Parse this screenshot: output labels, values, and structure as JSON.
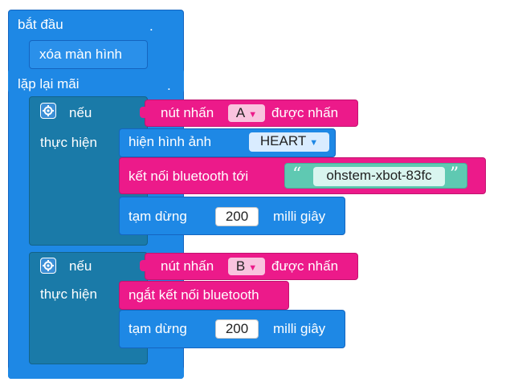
{
  "start_block": {
    "label": "bắt đầu",
    "dot": "."
  },
  "clear_block": {
    "label": "xóa màn hình"
  },
  "forever_block": {
    "label": "lặp lại mãi",
    "dot": "."
  },
  "if_blocks": [
    {
      "if_label": "nếu",
      "do_label": "thực hiện",
      "condition": {
        "prefix": "nút nhấn",
        "button": "A",
        "suffix": "được nhấn"
      },
      "show_image": {
        "label": "hiện hình ảnh",
        "image": "HEART"
      },
      "bt_connect": {
        "label": "kết nối bluetooth tới",
        "device": "ohstem-xbot-83fc"
      },
      "wait": {
        "label": "tạm dừng",
        "value": "200",
        "unit": "milli giây"
      }
    },
    {
      "if_label": "nếu",
      "do_label": "thực hiện",
      "condition": {
        "prefix": "nút nhấn",
        "button": "B",
        "suffix": "được nhấn"
      },
      "bt_disconnect": {
        "label": "ngắt kết nối bluetooth"
      },
      "wait": {
        "label": "tạm dừng",
        "value": "200",
        "unit": "milli giây"
      }
    }
  ],
  "icons": {
    "dropdown": "triangle-down",
    "settings": "gear-icon"
  },
  "colors": {
    "blue_block": "#1e88e5",
    "control_block": "#1a7aa8",
    "pink_block": "#ec1a8a",
    "field_pink": "#f9c3de",
    "field_blue": "#d9ecff",
    "field_string": "#d9f5ef"
  }
}
